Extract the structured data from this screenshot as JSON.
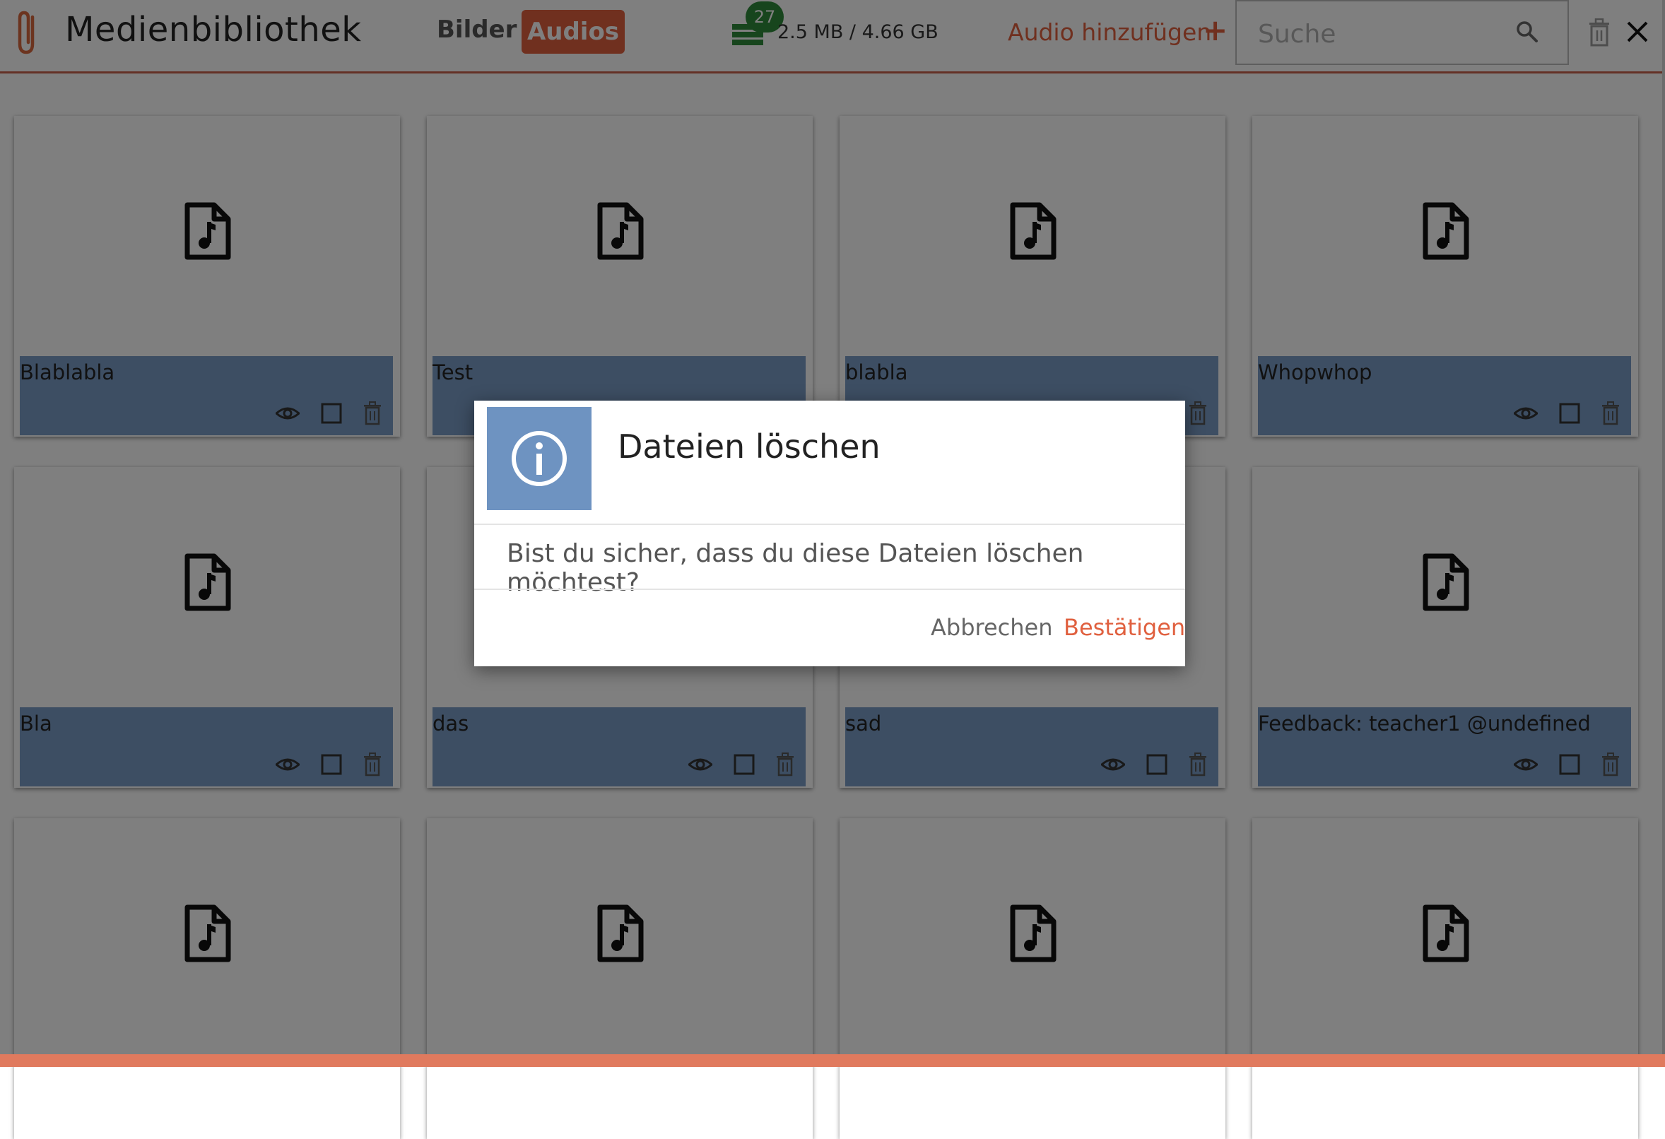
{
  "header": {
    "title": "Medienbibliothek",
    "tabs": [
      {
        "label": "Bilder",
        "active": false
      },
      {
        "label": "Audios",
        "active": true
      }
    ],
    "storage_badge": "27",
    "storage_text": "2.5 MB / 4.66 GB",
    "add_label": "Audio hinzufügen",
    "add_symbol": "+",
    "search_placeholder": "Suche"
  },
  "files": [
    {
      "name": "Blablabla"
    },
    {
      "name": "Test"
    },
    {
      "name": "blabla"
    },
    {
      "name": "Whopwhop"
    },
    {
      "name": "Bla"
    },
    {
      "name": "das"
    },
    {
      "name": "sad"
    },
    {
      "name": "Feedback: teacher1 @undefined"
    },
    {
      "name": ""
    },
    {
      "name": ""
    },
    {
      "name": ""
    },
    {
      "name": ""
    }
  ],
  "dialog": {
    "title": "Dateien löschen",
    "message": "Bist du sicher, dass du diese Dateien löschen möchtest?",
    "cancel_label": "Abbrechen",
    "confirm_label": "Bestätigen"
  },
  "colors": {
    "accent": "#e0603f",
    "caption_blue": "#7a9cc7",
    "info_blue": "#6e93c1",
    "badge_green": "#2f8a3a"
  },
  "icons": {
    "app": "paperclip-icon",
    "storage": "storage-icon",
    "search": "search-icon",
    "delete_all": "trash-icon",
    "close": "close-icon",
    "file": "audio-file-icon",
    "preview": "eye-icon",
    "select": "checkbox-icon",
    "delete": "trash-icon",
    "dialog": "info-icon"
  }
}
